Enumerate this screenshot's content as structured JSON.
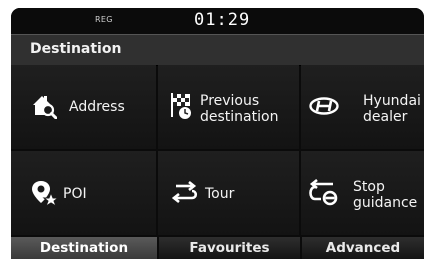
{
  "status": {
    "reg": "REG",
    "time": "01:29"
  },
  "title": "Destination",
  "menu": [
    {
      "icon": "house-search-icon",
      "label": "Address"
    },
    {
      "icon": "flag-clock-icon",
      "label": "Previous destination",
      "line1": "Previous",
      "line2": "destination"
    },
    {
      "icon": "hyundai-logo-icon",
      "label": "Hyundai dealer",
      "line1": "Hyundai",
      "line2": "dealer"
    },
    {
      "icon": "poi-pin-star-icon",
      "label": "POI"
    },
    {
      "icon": "tour-arrows-icon",
      "label": "Tour"
    },
    {
      "icon": "stop-guidance-icon",
      "label": "Stop guidance",
      "line1": "Stop",
      "line2": "guidance"
    }
  ],
  "tabs": [
    {
      "label": "Destination",
      "active": true
    },
    {
      "label": "Favourites",
      "active": false
    },
    {
      "label": "Advanced",
      "active": false
    }
  ]
}
